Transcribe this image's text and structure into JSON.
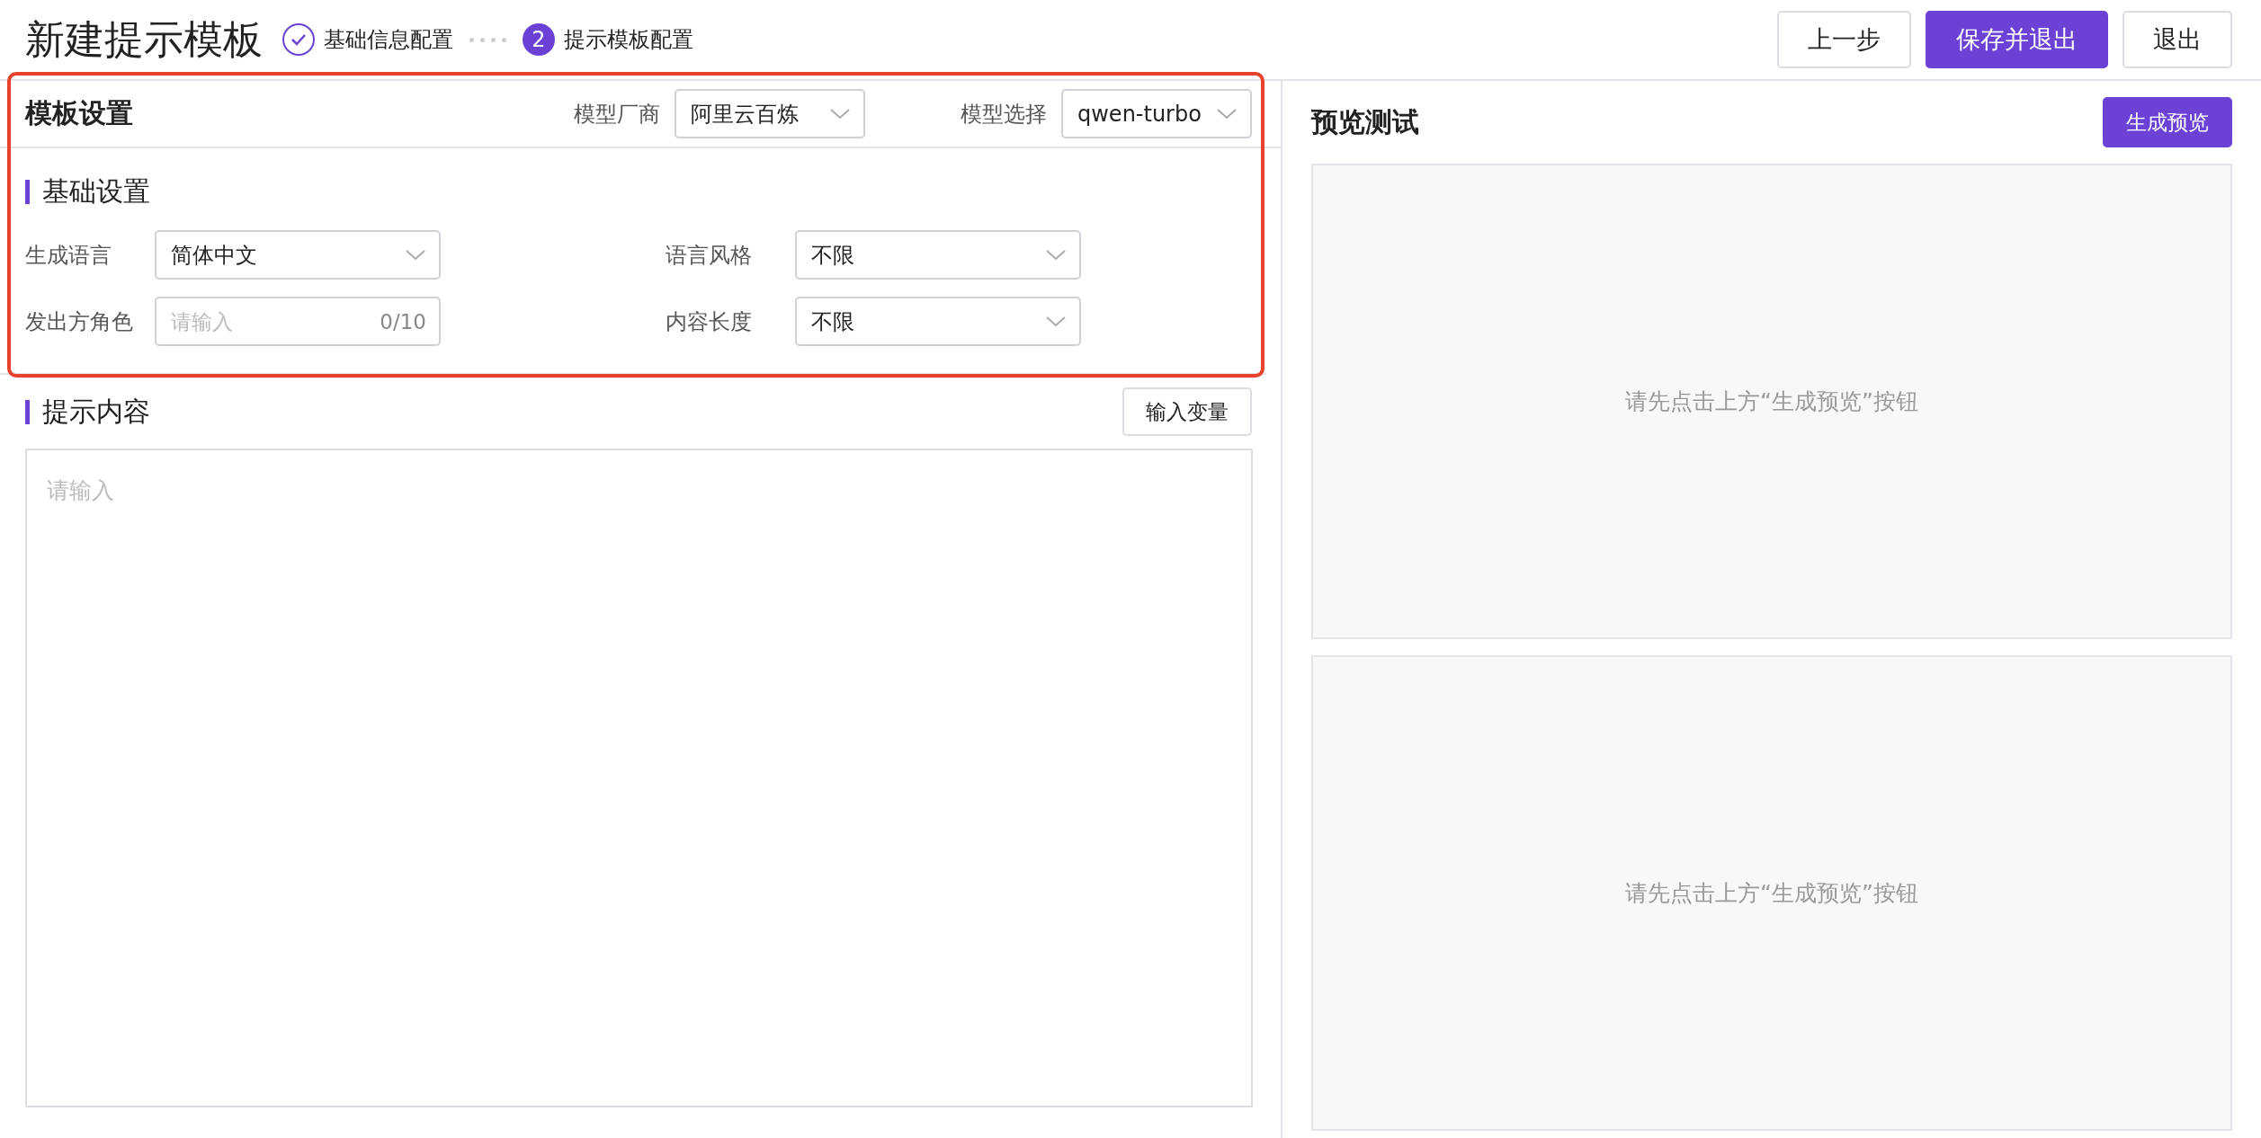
{
  "page": {
    "title": "新建提示模板"
  },
  "steps": [
    {
      "label": "基础信息配置",
      "completed": true
    },
    {
      "label": "提示模板配置",
      "completed": false,
      "number": "2"
    }
  ],
  "header_buttons": [
    {
      "label": "上一步",
      "primary": false
    },
    {
      "label": "保存并退出",
      "primary": true
    },
    {
      "label": "退出",
      "primary": false
    }
  ],
  "template_settings": {
    "title": "模板设置",
    "highlighted": true,
    "vendor": {
      "label": "模型厂商",
      "value": "阿里云百炼"
    },
    "model": {
      "label": "模型选择",
      "value": "qwen-turbo"
    }
  },
  "basic_settings": {
    "title": "基础设置",
    "fields": [
      {
        "label": "生成语言",
        "kind": "select",
        "value": "简体中文"
      },
      {
        "label": "语言风格",
        "kind": "select",
        "value": "不限"
      },
      {
        "label": "发出方角色",
        "kind": "input",
        "placeholder": "请输入",
        "counter": "0/10"
      },
      {
        "label": "内容长度",
        "kind": "select",
        "value": "不限"
      }
    ]
  },
  "prompt_content": {
    "title": "提示内容",
    "button": "输入变量",
    "placeholder": "请输入"
  },
  "preview": {
    "title": "预览测试",
    "button": "生成预览",
    "panels": [
      {
        "message": "请先点击上方“生成预览”按钮"
      },
      {
        "message": "请先点击上方“生成预览”按钮"
      }
    ]
  }
}
